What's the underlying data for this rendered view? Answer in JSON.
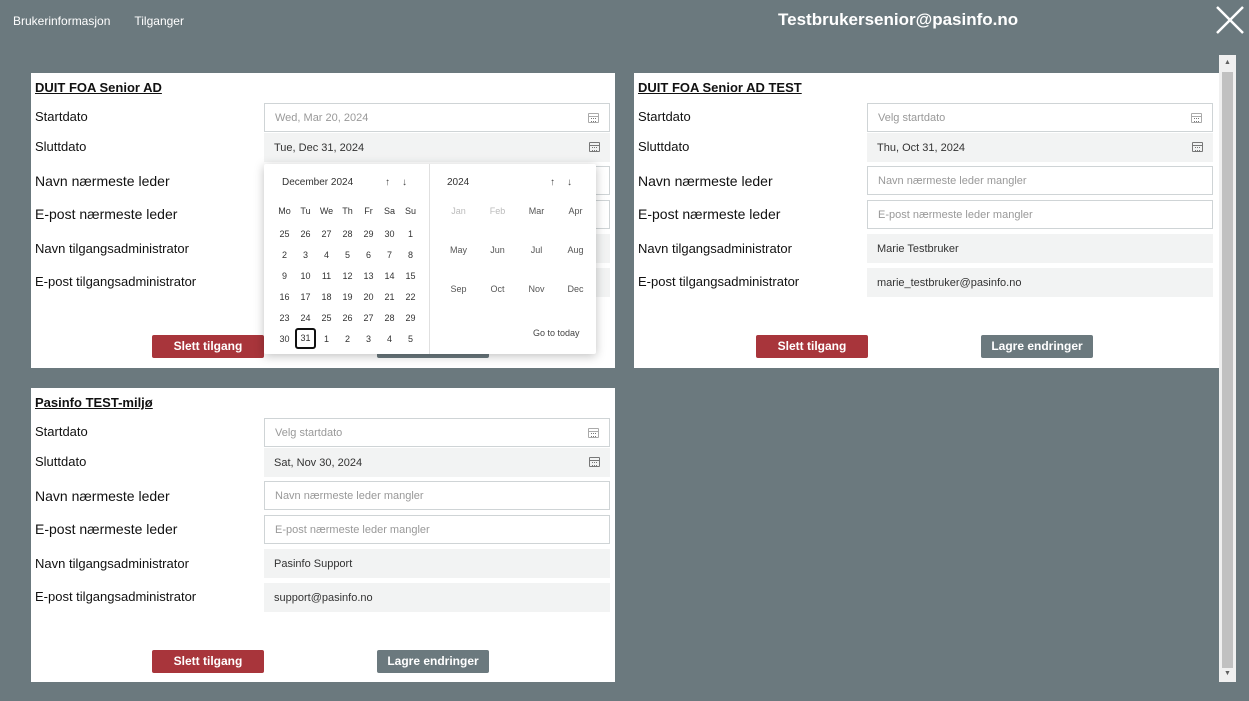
{
  "nav": {
    "tab_info": "Brukerinformasjon",
    "tab_access": "Tilganger"
  },
  "header": {
    "title": "Testbrukersenior@pasinfo.no"
  },
  "labels": {
    "start": "Startdato",
    "end": "Sluttdato",
    "manager_name": "Navn nærmeste leder",
    "manager_email": "E-post nærmeste leder",
    "admin_name": "Navn tilgangsadministrator",
    "admin_email": "E-post tilgangsadministrator",
    "delete": "Slett tilgang",
    "save": "Lagre endringer"
  },
  "cards": [
    {
      "title": "DUIT FOA Senior AD",
      "start": "Wed, Mar 20, 2024",
      "end": "Tue, Dec 31, 2024"
    },
    {
      "title": "DUIT FOA Senior AD TEST",
      "start_placeholder": "Velg startdato",
      "end": "Thu, Oct 31, 2024",
      "manager_name_placeholder": "Navn nærmeste leder mangler",
      "manager_email_placeholder": "E-post nærmeste leder mangler",
      "admin_name": "Marie Testbruker",
      "admin_email": "marie_testbruker@pasinfo.no"
    },
    {
      "title": "Pasinfo TEST-miljø",
      "start_placeholder": "Velg startdato",
      "end": "Sat, Nov 30, 2024",
      "manager_name_placeholder": "Navn nærmeste leder mangler",
      "manager_email_placeholder": "E-post nærmeste leder mangler",
      "admin_name": "Pasinfo Support",
      "admin_email": "support@pasinfo.no"
    }
  ],
  "datepicker": {
    "month_label": "December 2024",
    "year_label": "2024",
    "weekdays": [
      "Mo",
      "Tu",
      "We",
      "Th",
      "Fr",
      "Sa",
      "Su"
    ],
    "weeks": [
      [
        "25",
        "26",
        "27",
        "28",
        "29",
        "30",
        "1"
      ],
      [
        "2",
        "3",
        "4",
        "5",
        "6",
        "7",
        "8"
      ],
      [
        "9",
        "10",
        "11",
        "12",
        "13",
        "14",
        "15"
      ],
      [
        "16",
        "17",
        "18",
        "19",
        "20",
        "21",
        "22"
      ],
      [
        "23",
        "24",
        "25",
        "26",
        "27",
        "28",
        "29"
      ],
      [
        "30",
        "31",
        "1",
        "2",
        "3",
        "4",
        "5"
      ]
    ],
    "selected_day": "31",
    "months": [
      "Jan",
      "Feb",
      "Mar",
      "Apr",
      "May",
      "Jun",
      "Jul",
      "Aug",
      "Sep",
      "Oct",
      "Nov",
      "Dec"
    ],
    "go_to_today": "Go to today",
    "up_arrow": "↑",
    "down_arrow": "↓"
  },
  "colors": {
    "background": "#6b797e",
    "delete_button": "#a8353b",
    "save_button": "#6b797e"
  }
}
